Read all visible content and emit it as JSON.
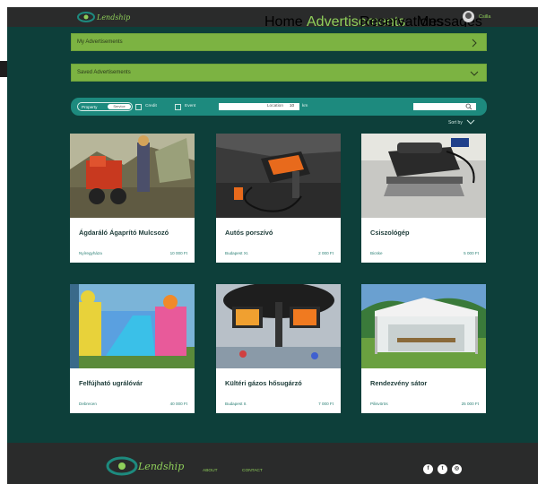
{
  "header": {
    "logo_text": "Lendship",
    "nav": [
      "Home",
      "Advertisements",
      "Reservations",
      "Messages"
    ],
    "active_nav": "Advertisements",
    "username": "Csilla"
  },
  "sections": {
    "my_ads": "My Advertisements",
    "saved_ads": "Saved Advertisements"
  },
  "filters": {
    "toggle_left": "Property",
    "toggle_right": "Service",
    "credit_label": "Credit",
    "event_label": "Event",
    "location_placeholder": "Location",
    "km_value": "10",
    "km_label": "km",
    "sort_label": "Sort by"
  },
  "listings": [
    {
      "title": "Ágdaráló Ágaprító Mulcsozó",
      "city": "Nyíregyháza",
      "price": "10 000 Ft"
    },
    {
      "title": "Autós porszívó",
      "city": "Budapest XI.",
      "price": "2 000 Ft"
    },
    {
      "title": "Csiszológép",
      "city": "Bicske",
      "price": "5 000 Ft"
    },
    {
      "title": "Felfújható ugrálóvár",
      "city": "Debrecen",
      "price": "40 000 Ft"
    },
    {
      "title": "Kültéri gázos hősugárzó",
      "city": "Budapest II.",
      "price": "7 000 Ft"
    },
    {
      "title": "Rendezvény sátor",
      "city": "Pilisvörös",
      "price": "25 000 Ft"
    }
  ],
  "footer": {
    "logo_text": "Lendship",
    "links": [
      "ABOUT",
      "CONTACT"
    ],
    "social_icons": [
      "facebook-icon",
      "twitter-icon",
      "instagram-icon"
    ]
  },
  "colors": {
    "main_bg": "#0d3f3a",
    "accent_green": "#7cb342",
    "teal": "#1d8a7e",
    "dark": "#2a2b2b"
  }
}
